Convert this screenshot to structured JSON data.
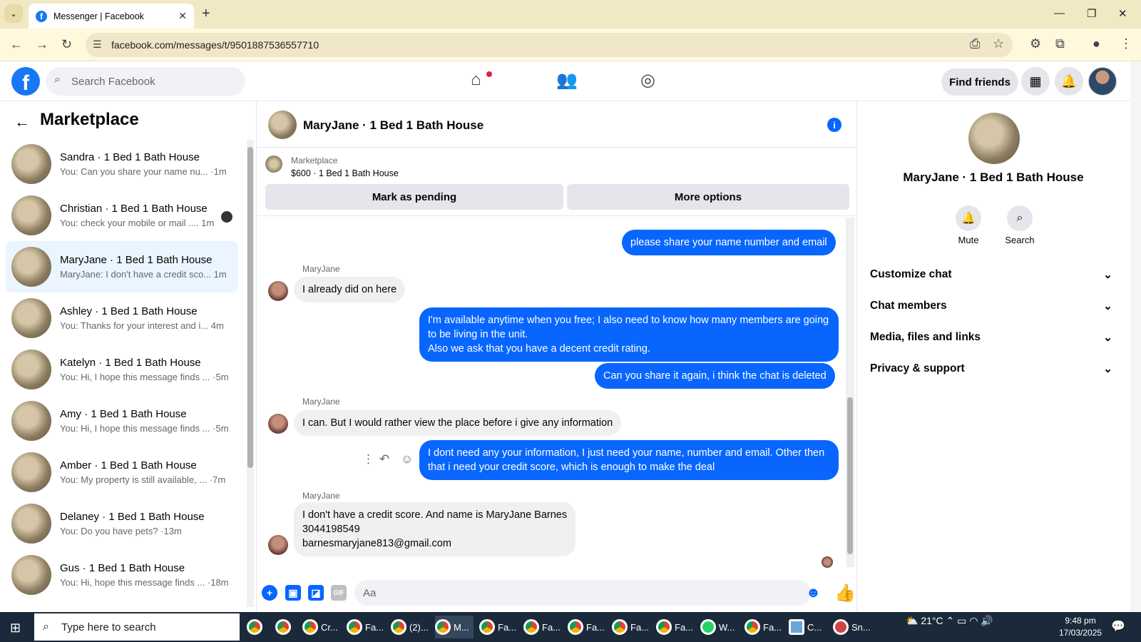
{
  "browser": {
    "tab_title": "Messenger | Facebook",
    "url": "facebook.com/messages/t/9501887536557710"
  },
  "header": {
    "search_placeholder": "Search Facebook",
    "find_friends": "Find friends"
  },
  "sidebar": {
    "title": "Marketplace",
    "conversations": [
      {
        "name": "Sandra · 1 Bed 1 Bath House",
        "preview": "You: Can you share your name nu... ·1m"
      },
      {
        "name": "Christian · 1 Bed 1 Bath House",
        "preview": "You: check your mobile or mail .... 1m"
      },
      {
        "name": "MaryJane · 1 Bed 1 Bath House",
        "preview": "MaryJane: I don't have a credit sco... 1m"
      },
      {
        "name": "Ashley · 1 Bed 1 Bath House",
        "preview": "You: Thanks for your interest and i... 4m"
      },
      {
        "name": "Katelyn · 1 Bed 1 Bath House",
        "preview": "You: Hi, I hope this message finds ... ·5m"
      },
      {
        "name": "Amy · 1 Bed 1 Bath House",
        "preview": "You: Hi, I hope this message finds ... ·5m"
      },
      {
        "name": "Amber · 1 Bed 1 Bath House",
        "preview": "You: My property is still available, ... ·7m"
      },
      {
        "name": "Delaney · 1 Bed 1 Bath House",
        "preview": "You: Do you have pets? ·13m"
      },
      {
        "name": "Gus · 1 Bed 1 Bath House",
        "preview": "You: Hi, hope this message finds ... ·18m"
      }
    ]
  },
  "chat": {
    "title": "MaryJane · 1 Bed 1 Bath House",
    "listing_label": "Marketplace",
    "listing_price": "$600 · 1 Bed 1 Bath House",
    "mark_pending": "Mark as pending",
    "more_options": "More options",
    "messages": [
      {
        "from": "me",
        "text": "please share your name number and email"
      },
      {
        "from": "MaryJane",
        "text": "I already did on here"
      },
      {
        "from": "me",
        "text": "I'm available anytime when you free; I also need to know how many members are going to be living in the unit.\nAlso we ask that you have a decent credit rating."
      },
      {
        "from": "me",
        "text": "Can you share it again, i think the chat is deleted"
      },
      {
        "from": "MaryJane",
        "text": "I can. But I would rather view the place before i give any information"
      },
      {
        "from": "me",
        "text": "I dont need any your information, I just need your name, number and email. Other then that i need your credit score, which is enough to make the deal"
      },
      {
        "from": "MaryJane",
        "text": "I don't have a credit score. And name is MaryJane Barnes\n3044198549\nbarnesmaryjane813@gmail.com"
      }
    ],
    "composer_placeholder": "Aa"
  },
  "info_panel": {
    "name": "MaryJane · 1 Bed 1 Bath House",
    "mute": "Mute",
    "search": "Search",
    "sections": [
      "Customize chat",
      "Chat members",
      "Media, files and links",
      "Privacy & support"
    ]
  },
  "taskbar": {
    "search_placeholder": "Type here to search",
    "apps": [
      "Cr...",
      "Fa...",
      "(2)...",
      "M...",
      "Fa...",
      "Fa...",
      "Fa...",
      "Fa...",
      "Fa...",
      "W...",
      "Fa...",
      "C...",
      "Sn..."
    ],
    "temperature": "21°C",
    "time": "9:48 pm",
    "date": "17/03/2025"
  },
  "colors": {
    "accent": "#0866ff",
    "brand": "#1877f2"
  }
}
